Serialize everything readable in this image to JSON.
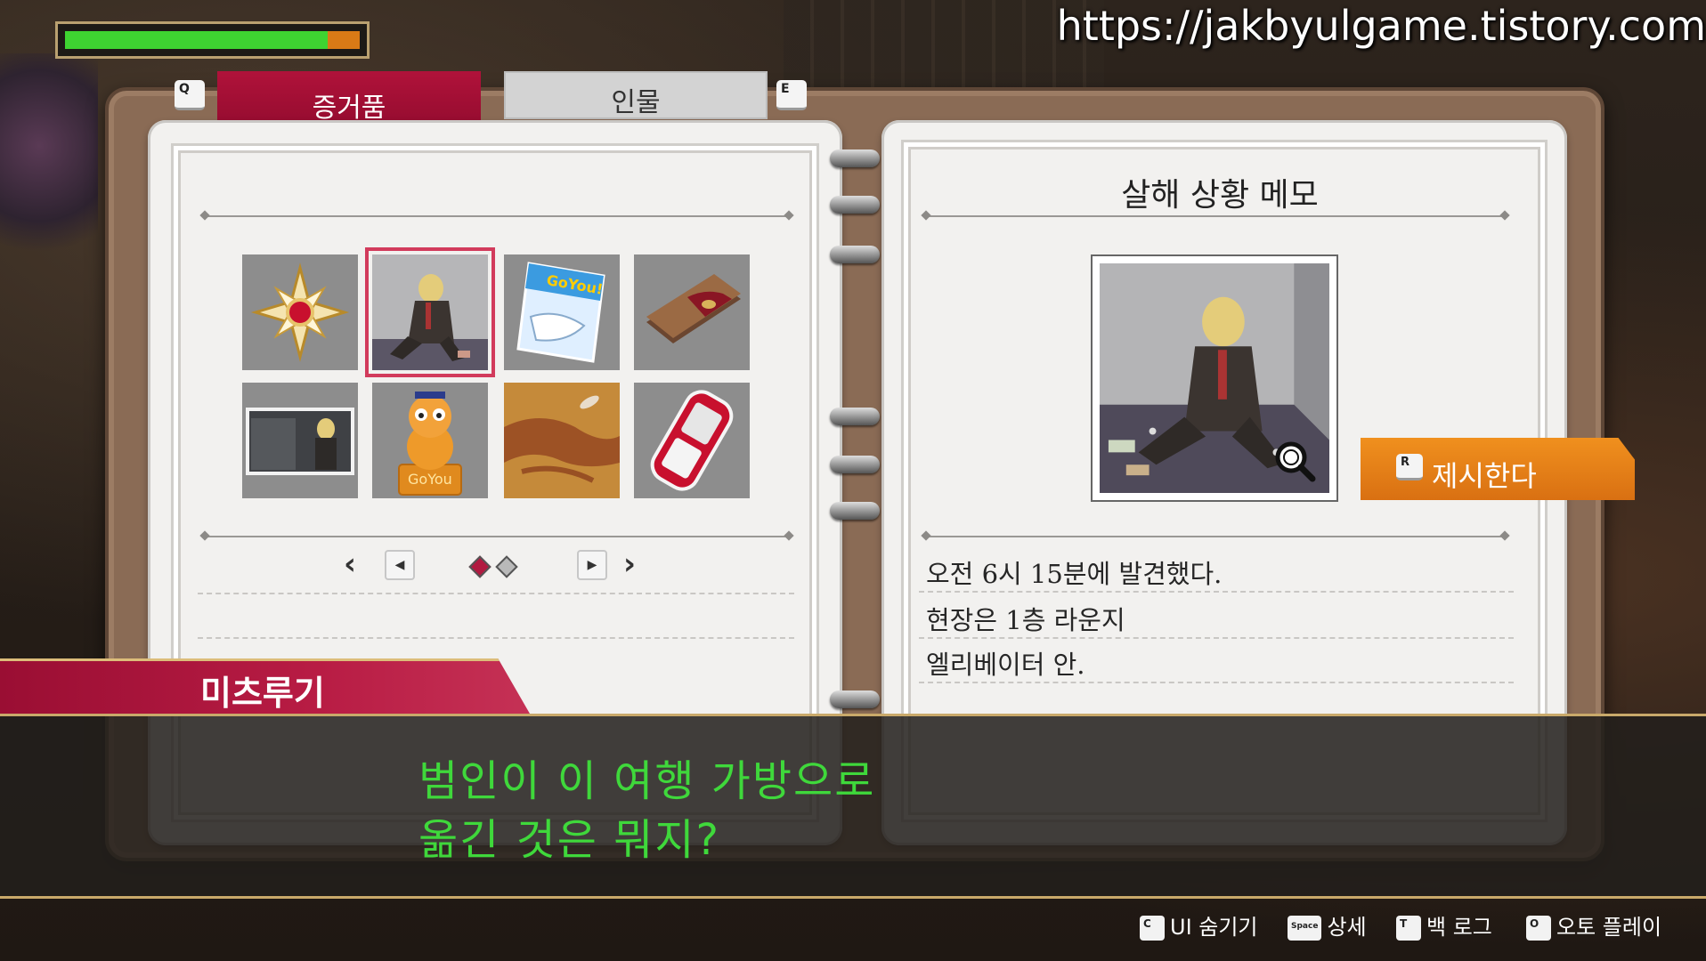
{
  "watermark": "https://jakbyulgame.tistory.com",
  "health": {
    "fraction": 0.89,
    "color": "#3ed331",
    "remainder_color": "#d97a16"
  },
  "tabs": {
    "left_key": "Q",
    "right_key": "E",
    "items": [
      {
        "label": "증거품",
        "active": true
      },
      {
        "label": "인물",
        "active": false
      }
    ]
  },
  "evidence": {
    "items": [
      {
        "icon": "gold-badge-icon"
      },
      {
        "icon": "victim-photo-icon",
        "selected": true
      },
      {
        "icon": "magazine-icon"
      },
      {
        "icon": "wallet-icon"
      },
      {
        "icon": "cctv-photo-icon"
      },
      {
        "icon": "cat-mascot-icon"
      },
      {
        "icon": "blood-stain-icon"
      },
      {
        "icon": "mobile-phone-icon"
      }
    ],
    "pagination": {
      "current": 1,
      "total": 2
    }
  },
  "memo": {
    "title": "살해 상황 메모",
    "lines": [
      "오전 6시 15분에 발견했다.",
      "현장은 1층 라운지",
      "엘리베이터 안."
    ]
  },
  "present": {
    "key": "R",
    "label": "제시한다"
  },
  "dialogue": {
    "speaker": "미츠루기",
    "lines": [
      "범인이 이 여행 가방으로",
      "옮긴 것은 뭐지?"
    ],
    "text_color": "#3fd83b"
  },
  "help_bar": [
    {
      "key": "C",
      "label": "UI 숨기기"
    },
    {
      "key": "Space",
      "label": "상세"
    },
    {
      "key": "T",
      "label": "백 로그"
    },
    {
      "key": "O",
      "label": "오토 플레이"
    }
  ],
  "colors": {
    "accent": "#a5103a",
    "present_button": "#e8821a"
  }
}
